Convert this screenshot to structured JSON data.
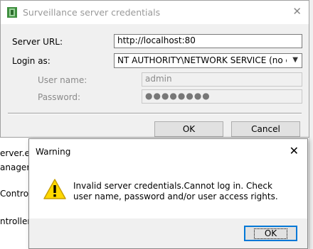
{
  "background": {
    "lines": [
      "erver.exe",
      "anager.e",
      "Control",
      "ntroller"
    ]
  },
  "dialog": {
    "title": "Surveillance server credentials",
    "close_icon": "close-icon",
    "server_url_label": "Server URL:",
    "server_url_value": "http://localhost:80",
    "login_as_label": "Login as:",
    "login_as_value": "NT AUTHORITY\\NETWORK SERVICE (no credentials)",
    "user_name_label": "User name:",
    "user_name_value": "admin",
    "password_label": "Password:",
    "password_value": "●●●●●●●●",
    "ok_label": "OK",
    "cancel_label": "Cancel"
  },
  "warning": {
    "title": "Warning",
    "close_icon": "close-icon",
    "icon": "warning-icon",
    "message": "Invalid server credentials.Cannot log in. Check user name, password and/or user access rights.",
    "ok_label": "OK"
  },
  "colors": {
    "accent": "#0078d7",
    "warning_yellow": "#ffd800"
  }
}
